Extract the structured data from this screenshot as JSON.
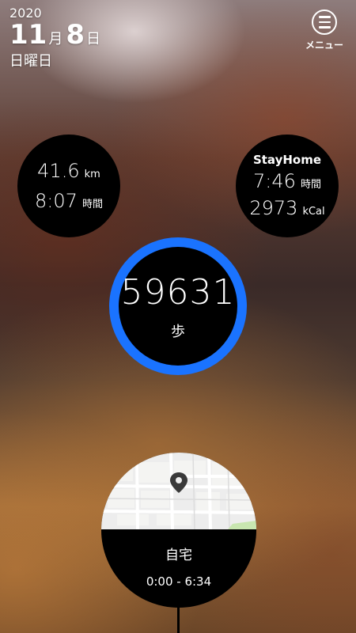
{
  "date": {
    "year": "2020",
    "month": "11",
    "month_suffix": "月",
    "day": "8",
    "day_suffix": "日",
    "weekday": "日曜日"
  },
  "menu": {
    "label": "メニュー",
    "icon": "hamburger-menu-icon"
  },
  "activity": {
    "distance_value": "41.6",
    "distance_unit": "km",
    "duration_value": "8:07",
    "duration_unit": "時間"
  },
  "stay": {
    "title": "StayHome",
    "duration_value": "7:46",
    "duration_unit": "時間",
    "calories_value": "2973",
    "calories_unit": "kCal"
  },
  "steps": {
    "value": "59631",
    "unit": "歩",
    "ring_color": "#1a73ff"
  },
  "location": {
    "name": "自宅",
    "time_range": "0:00 - 6:34",
    "icon": "map-pin-icon"
  }
}
